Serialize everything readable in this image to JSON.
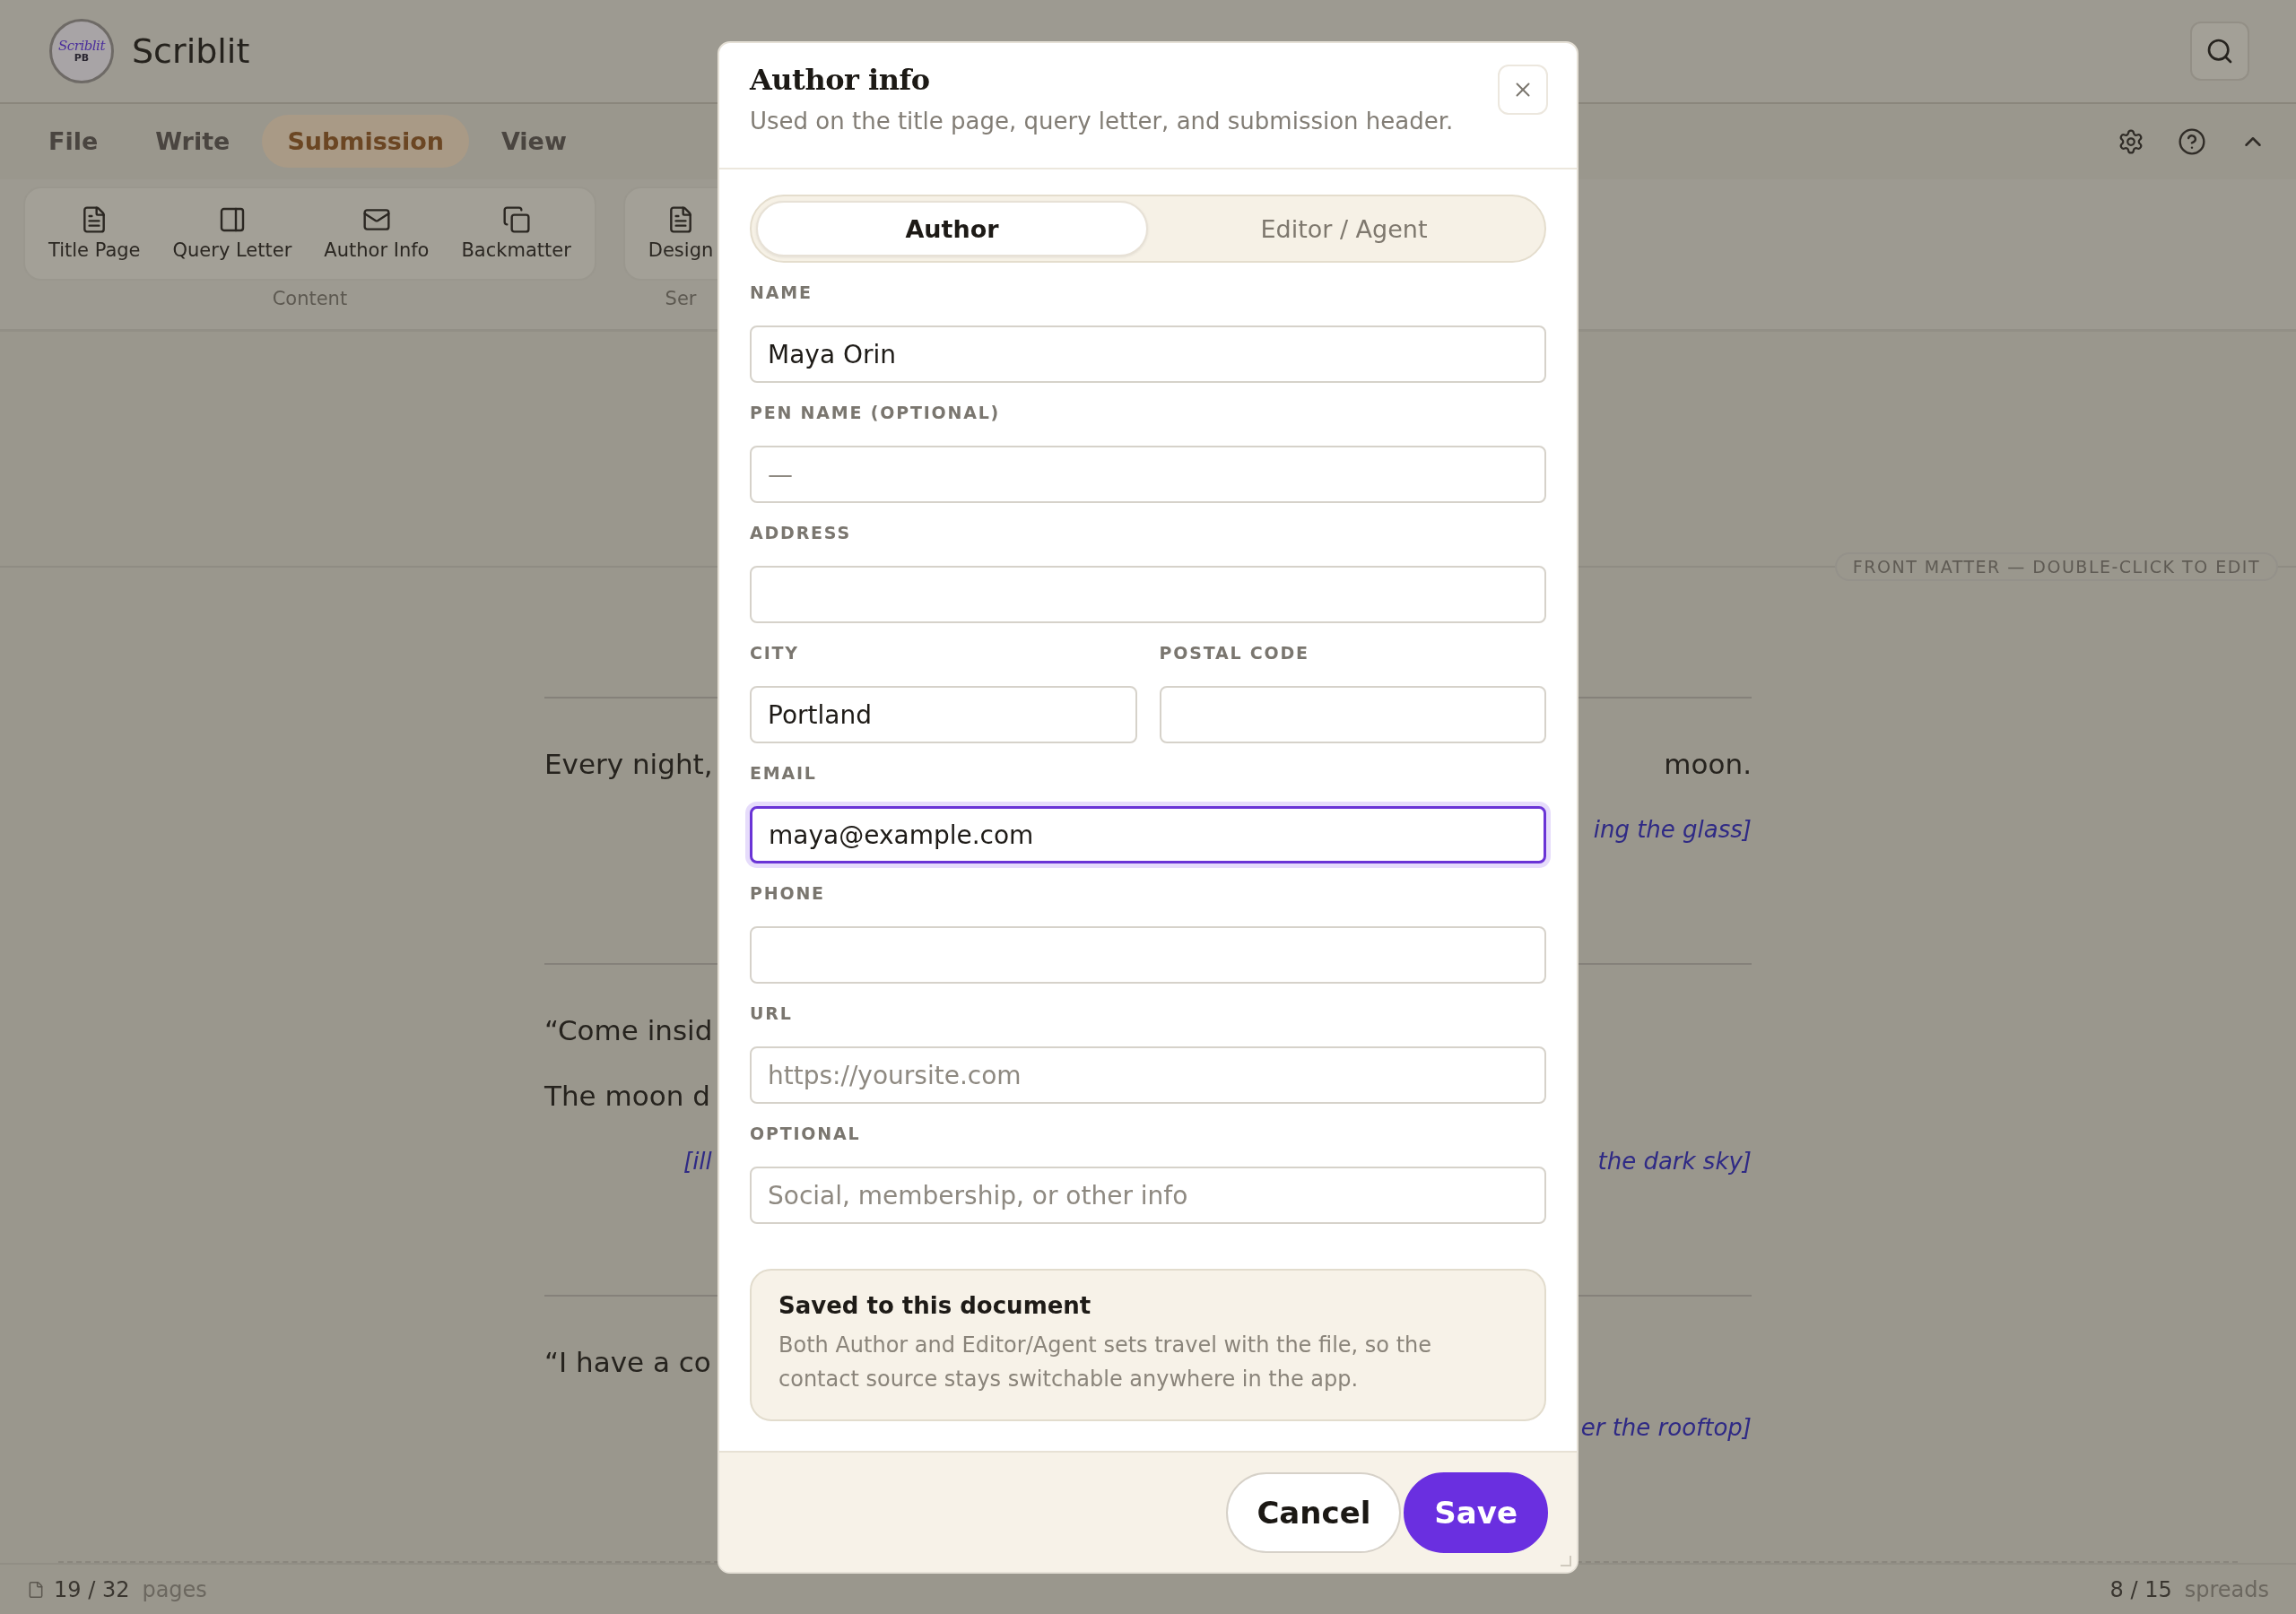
{
  "app": {
    "logo": {
      "script": "Scriblit",
      "mark": "PB"
    },
    "name": "Scriblit"
  },
  "menu_tabs": [
    {
      "label": "File",
      "selected": false
    },
    {
      "label": "Write",
      "selected": false
    },
    {
      "label": "Submission",
      "selected": true
    },
    {
      "label": "View",
      "selected": false
    }
  ],
  "ribbon_groups": [
    {
      "label": "Content",
      "items": [
        {
          "label": "Title Page",
          "kind": "document"
        },
        {
          "label": "Query Letter",
          "kind": "panel"
        },
        {
          "label": "Author Info",
          "kind": "mail"
        },
        {
          "label": "Backmatter",
          "kind": "copy"
        }
      ]
    },
    {
      "label": "Ser",
      "items": [
        {
          "label": "Design",
          "kind": "document"
        }
      ]
    }
  ],
  "document": {
    "badge": "FRONT MATTER — DOUBLE-CLICK TO EDIT",
    "sections": [
      {
        "lines": [
          {
            "kind": "text",
            "left": "Every night,",
            "right": "moon."
          },
          {
            "kind": "note",
            "right": "ing the glass]"
          }
        ]
      },
      {
        "lines": [
          {
            "kind": "text",
            "left": "“Come insid"
          },
          {
            "kind": "text",
            "left": "The moon d"
          },
          {
            "kind": "note",
            "left": "[ill",
            "right": "the dark sky]"
          }
        ]
      },
      {
        "lines": [
          {
            "kind": "text",
            "left": "“I have a co"
          },
          {
            "kind": "note",
            "right": "er the rooftop]"
          }
        ]
      }
    ]
  },
  "status_bar": {
    "pages": {
      "count": "19 / 32",
      "unit": "pages"
    },
    "spreads": {
      "count": "8 / 15",
      "unit": "spreads"
    }
  },
  "modal": {
    "title": "Author info",
    "subtitle": "Used on the title page, query letter, and submission header.",
    "tabs": [
      {
        "label": "Author",
        "selected": true
      },
      {
        "label": "Editor / Agent",
        "selected": false
      }
    ],
    "rows": [
      {
        "fields": [
          {
            "label": "NAME",
            "value": "Maya Orin",
            "focused": false
          }
        ]
      },
      {
        "fields": [
          {
            "label": "PEN NAME (OPTIONAL)",
            "placeholder": "—",
            "focused": false
          }
        ]
      },
      {
        "fields": [
          {
            "label": "ADDRESS",
            "focused": false
          }
        ]
      },
      {
        "fields": [
          {
            "label": "CITY",
            "value": "Portland",
            "focused": false
          },
          {
            "label": "POSTAL CODE",
            "focused": false
          }
        ]
      },
      {
        "fields": [
          {
            "label": "EMAIL",
            "value": "maya@example.com",
            "focused": true
          }
        ]
      },
      {
        "fields": [
          {
            "label": "PHONE",
            "focused": false
          }
        ]
      },
      {
        "fields": [
          {
            "label": "URL",
            "placeholder": "https://yoursite.com",
            "focused": false
          }
        ]
      },
      {
        "fields": [
          {
            "label": "OPTIONAL",
            "placeholder": "Social, membership, or other info",
            "focused": false
          }
        ]
      }
    ],
    "note": {
      "title": "Saved to this document",
      "text": "Both Author and Editor/Agent sets travel with the file, so the contact source stays switchable anywhere in the app."
    },
    "buttons": [
      {
        "label": "Cancel",
        "kind": "secondary"
      },
      {
        "label": "Save",
        "kind": "primary"
      }
    ]
  }
}
